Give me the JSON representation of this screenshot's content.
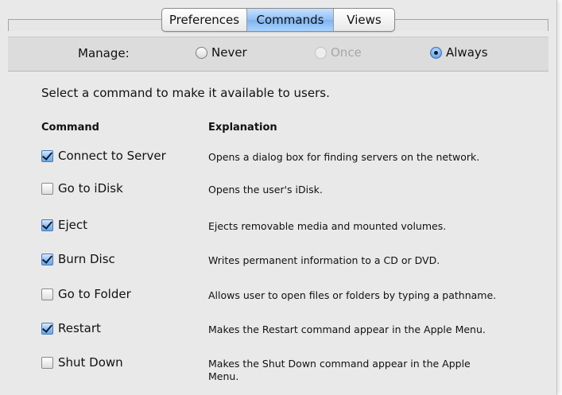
{
  "tabs": [
    {
      "label": "Preferences",
      "active": false
    },
    {
      "label": "Commands",
      "active": true
    },
    {
      "label": "Views",
      "active": false
    }
  ],
  "manage": {
    "label": "Manage:",
    "options": [
      {
        "label": "Never",
        "state": "unselected"
      },
      {
        "label": "Once",
        "state": "disabled"
      },
      {
        "label": "Always",
        "state": "selected"
      }
    ]
  },
  "intro_text": "Select a command to make it available to users.",
  "columns": {
    "command": "Command",
    "explanation": "Explanation"
  },
  "commands": [
    {
      "label": "Connect to Server",
      "checked": true,
      "explanation": "Opens a dialog box for finding servers on the network."
    },
    {
      "label": "Go to iDisk",
      "checked": false,
      "explanation": "Opens the user's iDisk."
    },
    {
      "label": "Eject",
      "checked": true,
      "explanation": "Ejects removable media and mounted volumes."
    },
    {
      "label": "Burn Disc",
      "checked": true,
      "explanation": "Writes permanent information to a CD or DVD."
    },
    {
      "label": "Go to Folder",
      "checked": false,
      "explanation": "Allows user to open files or folders by typing a pathname."
    },
    {
      "label": "Restart",
      "checked": true,
      "explanation": "Makes the Restart command appear in the Apple Menu."
    },
    {
      "label": "Shut Down",
      "checked": false,
      "explanation": "Makes the Shut Down command appear in the Apple Menu."
    }
  ]
}
